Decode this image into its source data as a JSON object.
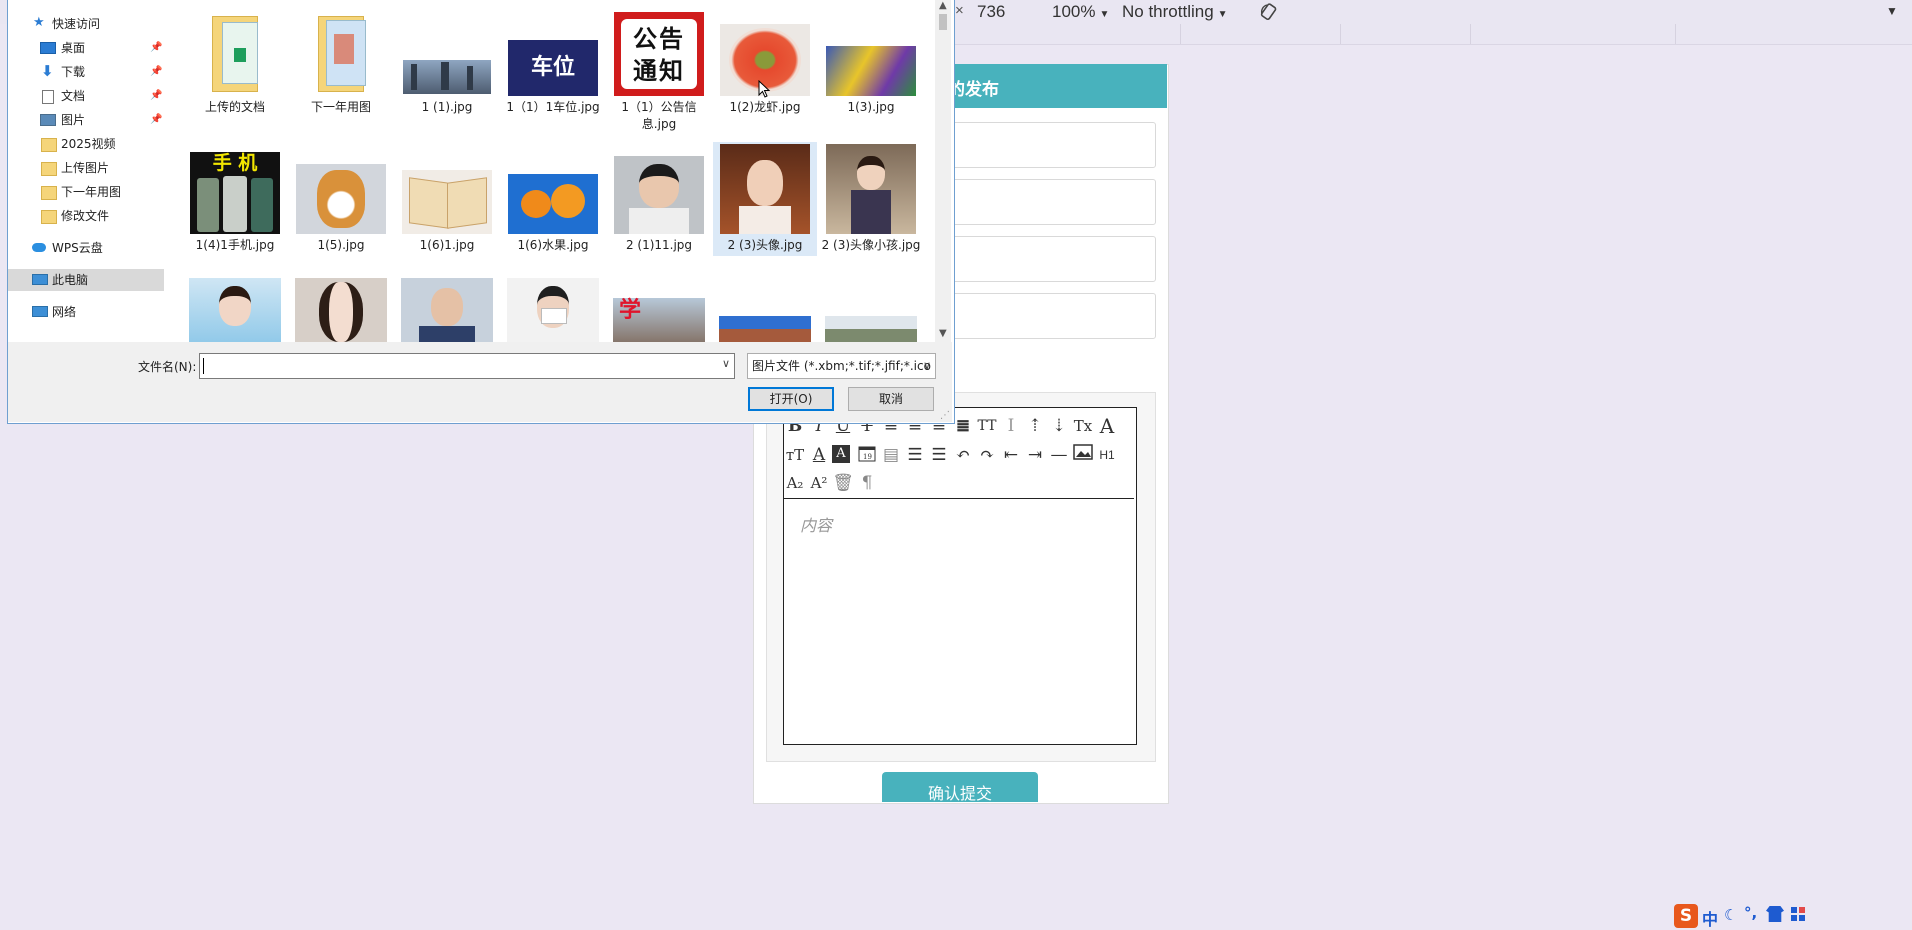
{
  "devtools": {
    "times": "×",
    "height": "736",
    "zoom": "100%",
    "throttle": "No throttling",
    "menu_arrow": "▼"
  },
  "form": {
    "header_title": "的发布",
    "editor_placeholder": "内容",
    "heading_button": "H1",
    "submit_label": "确认提交"
  },
  "dialog": {
    "nav": [
      {
        "label": "快速访问",
        "icon": "star-icon"
      },
      {
        "label": "桌面",
        "icon": "desktop-icon",
        "pinned": true
      },
      {
        "label": "下载",
        "icon": "download-icon",
        "pinned": true
      },
      {
        "label": "文档",
        "icon": "document-icon",
        "pinned": true
      },
      {
        "label": "图片",
        "icon": "picture-icon",
        "pinned": true
      },
      {
        "label": "2025视频",
        "icon": "folder-icon"
      },
      {
        "label": "上传图片",
        "icon": "folder-icon"
      },
      {
        "label": "下一年用图",
        "icon": "folder-icon"
      },
      {
        "label": "修改文件",
        "icon": "folder-icon"
      },
      {
        "label": "WPS云盘",
        "icon": "cloud-icon"
      },
      {
        "label": "此电脑",
        "icon": "computer-icon",
        "selected": true
      },
      {
        "label": "网络",
        "icon": "network-icon"
      }
    ],
    "files": [
      {
        "name": "上传的文档",
        "kind": "folder"
      },
      {
        "name": "下一年用图",
        "kind": "folder"
      },
      {
        "name": "1 (1).jpg",
        "kind": "city"
      },
      {
        "name": "1（1）1车位.jpg",
        "kind": "parking",
        "thumb_text": "车位"
      },
      {
        "name": "1（1）公告信息.jpg",
        "kind": "notice",
        "thumb_text": "公告通知"
      },
      {
        "name": "1(2)龙虾.jpg",
        "kind": "lobster"
      },
      {
        "name": "1(3).jpg",
        "kind": "anime"
      },
      {
        "name": "1(4)1手机.jpg",
        "kind": "phone",
        "thumb_text": "手 机"
      },
      {
        "name": "1(5).jpg",
        "kind": "dog"
      },
      {
        "name": "1(6)1.jpg",
        "kind": "book"
      },
      {
        "name": "1(6)水果.jpg",
        "kind": "orange"
      },
      {
        "name": "2 (1)11.jpg",
        "kind": "man"
      },
      {
        "name": "2 (3)头像.jpg",
        "kind": "woman",
        "selected": true
      },
      {
        "name": "2 (3)头像小孩.jpg",
        "kind": "girl"
      },
      {
        "name": "",
        "kind": "p1"
      },
      {
        "name": "",
        "kind": "p2"
      },
      {
        "name": "",
        "kind": "p3"
      },
      {
        "name": "",
        "kind": "p4"
      },
      {
        "name": "",
        "kind": "school",
        "thumb_text": "学"
      },
      {
        "name": "",
        "kind": "building"
      },
      {
        "name": "",
        "kind": "campus"
      }
    ],
    "filename_label": "文件名(N):",
    "filename_value": "",
    "filter_label": "图片文件 (*.xbm;*.tif;*.jfif;*.ico",
    "open_label": "打开(O)",
    "cancel_label": "取消"
  },
  "taskbar": {
    "ime_logo": "S",
    "ime_lang": "中"
  }
}
